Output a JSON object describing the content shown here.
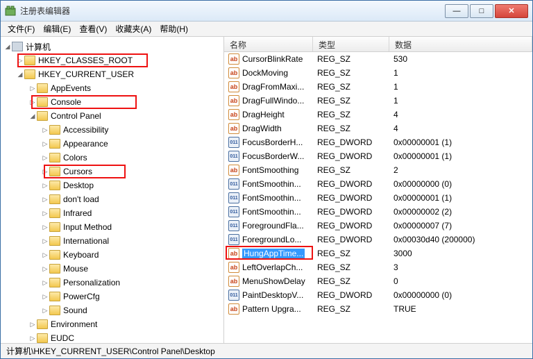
{
  "window": {
    "title": "注册表编辑器"
  },
  "menu": {
    "file": "文件(F)",
    "edit": "编辑(E)",
    "view": "查看(V)",
    "fav": "收藏夹(A)",
    "help": "帮助(H)"
  },
  "tree": {
    "root": "计算机",
    "hives": [
      "HKEY_CLASSES_ROOT",
      "HKEY_CURRENT_USER"
    ],
    "hkcu_children": [
      "AppEvents",
      "Console",
      "Control Panel"
    ],
    "cp_children": [
      "Accessibility",
      "Appearance",
      "Colors",
      "Cursors",
      "Desktop",
      "don't load",
      "Infrared",
      "Input Method",
      "International",
      "Keyboard",
      "Mouse",
      "Personalization",
      "PowerCfg",
      "Sound"
    ],
    "hkcu_tail": [
      "Environment",
      "EUDC"
    ]
  },
  "cols": {
    "name": "名称",
    "type": "类型",
    "data": "数据"
  },
  "values": [
    {
      "n": "CursorBlinkRate",
      "t": "REG_SZ",
      "d": "530",
      "k": "sz"
    },
    {
      "n": "DockMoving",
      "t": "REG_SZ",
      "d": "1",
      "k": "sz"
    },
    {
      "n": "DragFromMaxi...",
      "t": "REG_SZ",
      "d": "1",
      "k": "sz"
    },
    {
      "n": "DragFullWindo...",
      "t": "REG_SZ",
      "d": "1",
      "k": "sz"
    },
    {
      "n": "DragHeight",
      "t": "REG_SZ",
      "d": "4",
      "k": "sz"
    },
    {
      "n": "DragWidth",
      "t": "REG_SZ",
      "d": "4",
      "k": "sz"
    },
    {
      "n": "FocusBorderH...",
      "t": "REG_DWORD",
      "d": "0x00000001 (1)",
      "k": "dw"
    },
    {
      "n": "FocusBorderW...",
      "t": "REG_DWORD",
      "d": "0x00000001 (1)",
      "k": "dw"
    },
    {
      "n": "FontSmoothing",
      "t": "REG_SZ",
      "d": "2",
      "k": "sz"
    },
    {
      "n": "FontSmoothin...",
      "t": "REG_DWORD",
      "d": "0x00000000 (0)",
      "k": "dw"
    },
    {
      "n": "FontSmoothin...",
      "t": "REG_DWORD",
      "d": "0x00000001 (1)",
      "k": "dw"
    },
    {
      "n": "FontSmoothin...",
      "t": "REG_DWORD",
      "d": "0x00000002 (2)",
      "k": "dw"
    },
    {
      "n": "ForegroundFla...",
      "t": "REG_DWORD",
      "d": "0x00000007 (7)",
      "k": "dw"
    },
    {
      "n": "ForegroundLo...",
      "t": "REG_DWORD",
      "d": "0x00030d40 (200000)",
      "k": "dw"
    },
    {
      "n": "HungAppTime...",
      "t": "REG_SZ",
      "d": "3000",
      "k": "sz",
      "sel": true
    },
    {
      "n": "LeftOverlapCh...",
      "t": "REG_SZ",
      "d": "3",
      "k": "sz"
    },
    {
      "n": "MenuShowDelay",
      "t": "REG_SZ",
      "d": "0",
      "k": "sz"
    },
    {
      "n": "PaintDesktopV...",
      "t": "REG_DWORD",
      "d": "0x00000000 (0)",
      "k": "dw"
    },
    {
      "n": "Pattern Upgra...",
      "t": "REG_SZ",
      "d": "TRUE",
      "k": "sz"
    }
  ],
  "status": "计算机\\HKEY_CURRENT_USER\\Control Panel\\Desktop",
  "icon_labels": {
    "sz": "ab",
    "dw": "011"
  }
}
